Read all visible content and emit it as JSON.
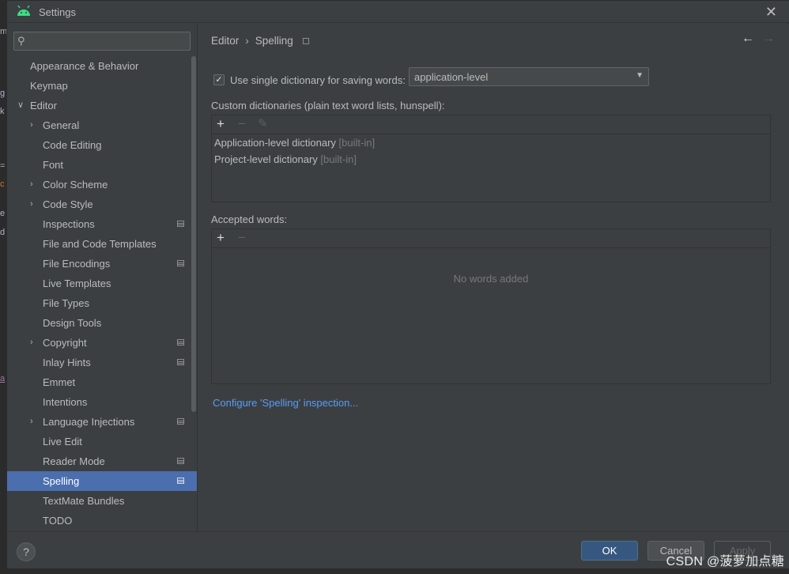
{
  "window": {
    "title": "Settings",
    "close_glyph": "✕",
    "app_icon": "android-icon"
  },
  "left_strip": {
    "fragments": [
      "m",
      "g",
      "k",
      "=",
      "c",
      "e",
      "d",
      "a"
    ]
  },
  "search": {
    "value": "",
    "placeholder": "",
    "icon": "search-icon"
  },
  "sidebar": {
    "items": [
      {
        "label": "Appearance & Behavior",
        "level": 0,
        "chevron": "",
        "project": false,
        "selected": false
      },
      {
        "label": "Keymap",
        "level": 0,
        "chevron": "",
        "project": false,
        "selected": false
      },
      {
        "label": "Editor",
        "level": 0,
        "chevron": "∨",
        "project": false,
        "selected": false
      },
      {
        "label": "General",
        "level": 1,
        "chevron": "›",
        "project": false,
        "selected": false
      },
      {
        "label": "Code Editing",
        "level": 1,
        "chevron": "",
        "project": false,
        "selected": false
      },
      {
        "label": "Font",
        "level": 1,
        "chevron": "",
        "project": false,
        "selected": false
      },
      {
        "label": "Color Scheme",
        "level": 1,
        "chevron": "›",
        "project": false,
        "selected": false
      },
      {
        "label": "Code Style",
        "level": 1,
        "chevron": "›",
        "project": false,
        "selected": false
      },
      {
        "label": "Inspections",
        "level": 1,
        "chevron": "",
        "project": true,
        "selected": false
      },
      {
        "label": "File and Code Templates",
        "level": 1,
        "chevron": "",
        "project": false,
        "selected": false
      },
      {
        "label": "File Encodings",
        "level": 1,
        "chevron": "",
        "project": true,
        "selected": false
      },
      {
        "label": "Live Templates",
        "level": 1,
        "chevron": "",
        "project": false,
        "selected": false
      },
      {
        "label": "File Types",
        "level": 1,
        "chevron": "",
        "project": false,
        "selected": false
      },
      {
        "label": "Design Tools",
        "level": 1,
        "chevron": "",
        "project": false,
        "selected": false
      },
      {
        "label": "Copyright",
        "level": 1,
        "chevron": "›",
        "project": true,
        "selected": false
      },
      {
        "label": "Inlay Hints",
        "level": 1,
        "chevron": "",
        "project": true,
        "selected": false
      },
      {
        "label": "Emmet",
        "level": 1,
        "chevron": "",
        "project": false,
        "selected": false
      },
      {
        "label": "Intentions",
        "level": 1,
        "chevron": "",
        "project": false,
        "selected": false
      },
      {
        "label": "Language Injections",
        "level": 1,
        "chevron": "›",
        "project": true,
        "selected": false
      },
      {
        "label": "Live Edit",
        "level": 1,
        "chevron": "",
        "project": false,
        "selected": false
      },
      {
        "label": "Reader Mode",
        "level": 1,
        "chevron": "",
        "project": true,
        "selected": false
      },
      {
        "label": "Spelling",
        "level": 1,
        "chevron": "",
        "project": true,
        "selected": true
      },
      {
        "label": "TextMate Bundles",
        "level": 1,
        "chevron": "",
        "project": false,
        "selected": false
      },
      {
        "label": "TODO",
        "level": 1,
        "chevron": "",
        "project": false,
        "selected": false
      }
    ]
  },
  "breadcrumb": {
    "parent": "Editor",
    "separator": "›",
    "current": "Spelling"
  },
  "nav": {
    "back": "←",
    "forward": "→"
  },
  "options": {
    "checkbox_checked": "✓",
    "single_dict_label": "Use single dictionary for saving words:",
    "dictionary_select": "application-level",
    "dropdown_arrow": "▼"
  },
  "custom_dicts": {
    "label": "Custom dictionaries (plain text word lists, hunspell):",
    "add": "+",
    "remove": "−",
    "edit": "✎",
    "rows": [
      {
        "name": "Application-level dictionary",
        "tag": "[built-in]"
      },
      {
        "name": "Project-level dictionary",
        "tag": "[built-in]"
      }
    ]
  },
  "accepted_words": {
    "label": "Accepted words:",
    "add": "+",
    "remove": "−",
    "empty": "No words added"
  },
  "configure_link": "Configure 'Spelling' inspection...",
  "footer": {
    "help": "?",
    "ok": "OK",
    "cancel": "Cancel",
    "apply": "Apply"
  },
  "watermark": "CSDN @菠萝加点糖",
  "colors": {
    "selection": "#4b6eaf",
    "link": "#589df6",
    "ok_button": "#365880",
    "android": "#3ddc84"
  }
}
